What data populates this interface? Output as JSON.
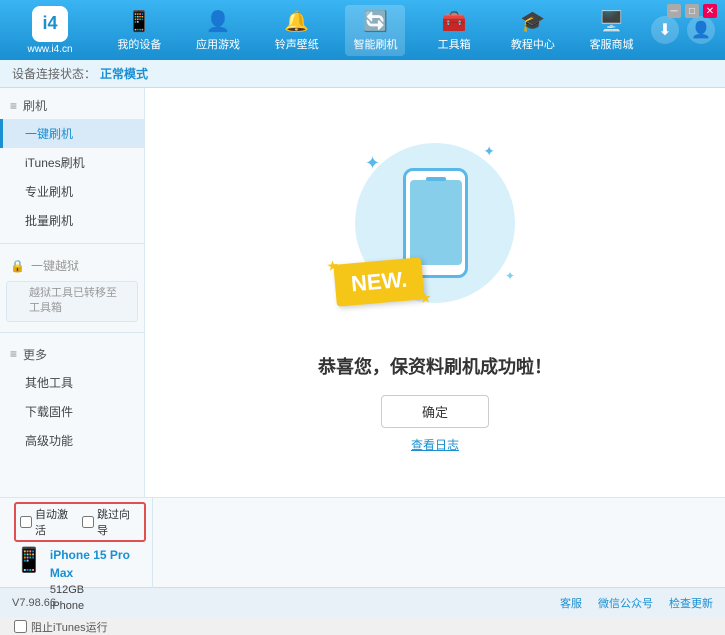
{
  "app": {
    "logo_text": "www.i4.cn",
    "logo_symbol": "i4"
  },
  "nav": {
    "items": [
      {
        "id": "my-device",
        "label": "我的设备",
        "icon": "📱"
      },
      {
        "id": "apps-games",
        "label": "应用游戏",
        "icon": "👤"
      },
      {
        "id": "ringtones",
        "label": "铃声壁纸",
        "icon": "🔔"
      },
      {
        "id": "smart-flash",
        "label": "智能刷机",
        "icon": "🔄",
        "active": true
      },
      {
        "id": "toolbox",
        "label": "工具箱",
        "icon": "🧰"
      },
      {
        "id": "tutorial",
        "label": "教程中心",
        "icon": "🎓"
      },
      {
        "id": "service",
        "label": "客服商城",
        "icon": "🖥️"
      }
    ],
    "download_btn": "⬇",
    "account_btn": "👤"
  },
  "status_bar": {
    "prefix": "设备连接状态：",
    "mode_label": "正常模式"
  },
  "sidebar": {
    "flash_section": {
      "header": "刷机",
      "items": [
        {
          "id": "onekey-flash",
          "label": "一键刷机",
          "active": true
        },
        {
          "id": "itunes-flash",
          "label": "iTunes刷机"
        },
        {
          "id": "pro-flash",
          "label": "专业刷机"
        },
        {
          "id": "batch-flash",
          "label": "批量刷机"
        }
      ]
    },
    "onekey_jailbreak": {
      "header": "一键越狱",
      "disabled": true,
      "note": "越狱工具已转移至\n工具箱"
    },
    "more_section": {
      "header": "更多",
      "items": [
        {
          "id": "other-tools",
          "label": "其他工具"
        },
        {
          "id": "download-firmware",
          "label": "下载固件"
        },
        {
          "id": "advanced",
          "label": "高级功能"
        }
      ]
    }
  },
  "main": {
    "success_title": "恭喜您，保资料刷机成功啦！",
    "confirm_btn": "确定",
    "log_link": "查看日志",
    "new_badge": "NEW.",
    "illustration": {
      "sparkles": [
        "✦",
        "✦",
        "✦"
      ]
    }
  },
  "bottom": {
    "auto_activate_label": "自动激活",
    "guide_label": "跳过向导",
    "device": {
      "name": "iPhone 15 Pro Max",
      "storage": "512GB",
      "type": "iPhone",
      "icon": "📱"
    },
    "itunes_label": "阻止iTunes运行"
  },
  "footer": {
    "version": "V7.98.66",
    "links": [
      {
        "id": "feedback",
        "label": "客服"
      },
      {
        "id": "wechat",
        "label": "微信公众号"
      },
      {
        "id": "check-update",
        "label": "检查更新"
      }
    ]
  },
  "window_controls": {
    "min": "─",
    "max": "□",
    "close": "✕"
  }
}
